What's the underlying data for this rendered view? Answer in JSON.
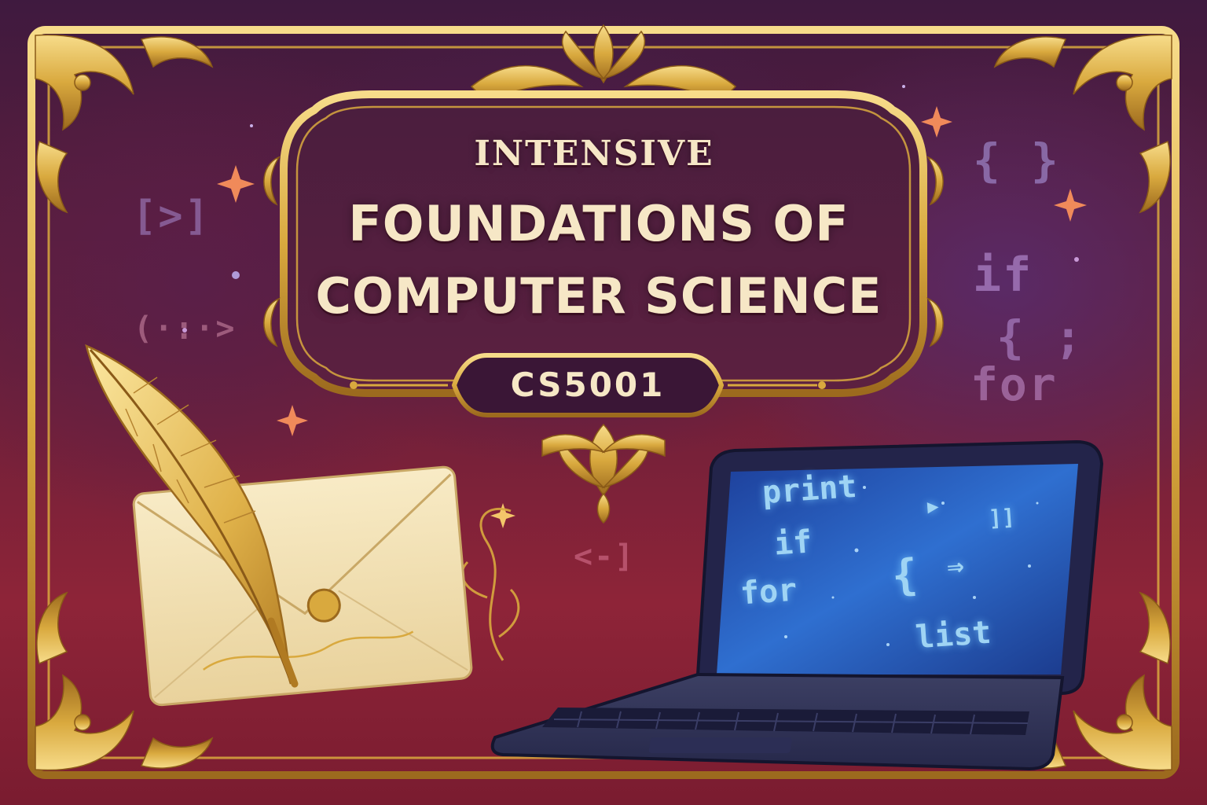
{
  "title": {
    "line1": "INTENSIVE",
    "line2": "FOUNDATIONS OF",
    "line3": "COMPUTER SCIENCE",
    "course_code": "CS5001"
  },
  "background_code": [
    "[>]",
    "(·:·>",
    "{ }",
    "if",
    "{ ;",
    "for",
    "<-]"
  ],
  "screen_code": {
    "print": "print",
    "if": "if",
    "for": "for",
    "list": "list",
    "brace": "{",
    "arrow": "⇒",
    "play": "▶",
    "brackets": "]]"
  },
  "colors": {
    "gold": "#d9a93e",
    "gold_light": "#f3d27a",
    "plum": "#4a1f4e",
    "crimson": "#8e2438",
    "cream": "#f6e7c6",
    "screen_blue": "#2f6fd0"
  }
}
